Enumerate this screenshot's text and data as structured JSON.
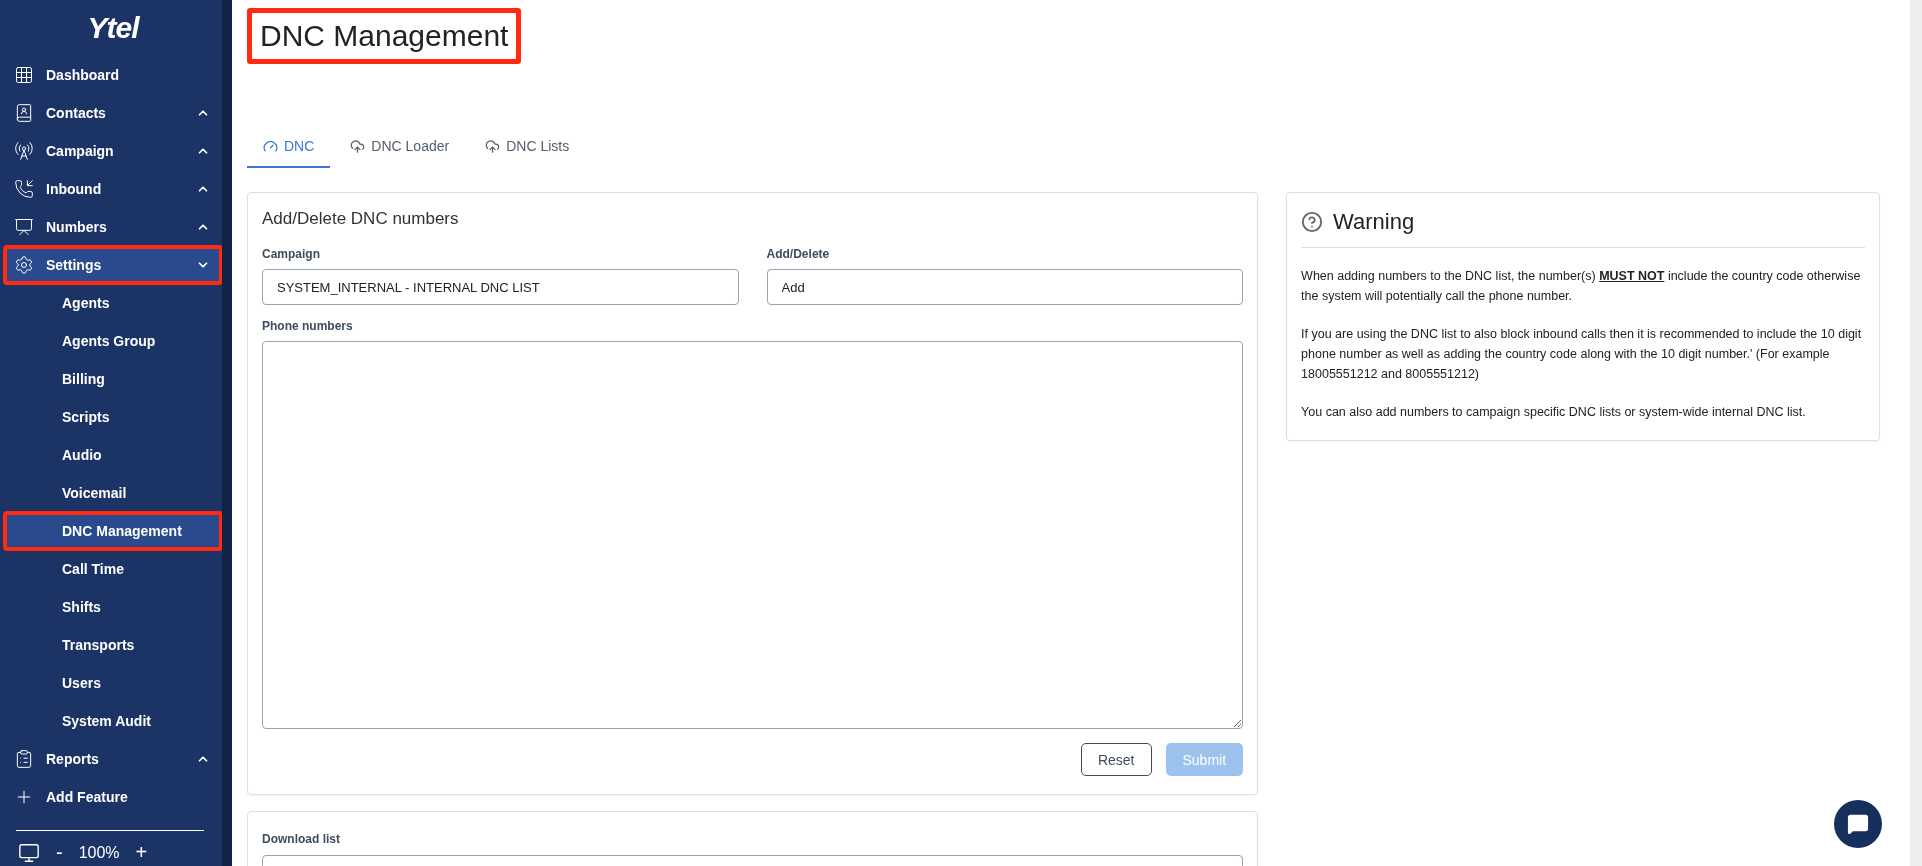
{
  "sidebar": {
    "logo": "Ytel",
    "items": [
      {
        "label": "Dashboard",
        "selected": false,
        "highlighted": false
      },
      {
        "label": "Contacts",
        "selected": false,
        "highlighted": false,
        "expanded": false
      },
      {
        "label": "Campaign",
        "selected": false,
        "highlighted": false,
        "expanded": false
      },
      {
        "label": "Inbound",
        "selected": false,
        "highlighted": false,
        "expanded": false
      },
      {
        "label": "Numbers",
        "selected": false,
        "highlighted": false,
        "expanded": false
      },
      {
        "label": "Settings",
        "selected": true,
        "highlighted": true,
        "expanded": true,
        "children": [
          {
            "label": "Agents",
            "selected": false,
            "highlighted": false
          },
          {
            "label": "Agents Group",
            "selected": false,
            "highlighted": false
          },
          {
            "label": "Billing",
            "selected": false,
            "highlighted": false
          },
          {
            "label": "Scripts",
            "selected": false,
            "highlighted": false
          },
          {
            "label": "Audio",
            "selected": false,
            "highlighted": false
          },
          {
            "label": "Voicemail",
            "selected": false,
            "highlighted": false
          },
          {
            "label": "DNC Management",
            "selected": true,
            "highlighted": true
          },
          {
            "label": "Call Time",
            "selected": false,
            "highlighted": false
          },
          {
            "label": "Shifts",
            "selected": false,
            "highlighted": false
          },
          {
            "label": "Transports",
            "selected": false,
            "highlighted": false
          },
          {
            "label": "Users",
            "selected": false,
            "highlighted": false
          },
          {
            "label": "System Audit",
            "selected": false,
            "highlighted": false
          }
        ]
      },
      {
        "label": "Reports",
        "selected": false,
        "highlighted": false,
        "expanded": false
      },
      {
        "label": "Add Feature",
        "selected": false,
        "highlighted": false
      }
    ],
    "zoom": {
      "minus": "-",
      "value": "100%",
      "plus": "+"
    }
  },
  "page_title": {
    "text": "DNC Management",
    "highlighted": true
  },
  "tabs": [
    {
      "label": "DNC",
      "selected": true
    },
    {
      "label": "DNC Loader",
      "selected": false
    },
    {
      "label": "DNC Lists",
      "selected": false
    }
  ],
  "form": {
    "title": "Add/Delete DNC numbers",
    "campaign": {
      "label": "Campaign",
      "value": "SYSTEM_INTERNAL - INTERNAL DNC LIST"
    },
    "action": {
      "label": "Add/Delete",
      "value": "Add"
    },
    "phone_numbers": {
      "label": "Phone numbers"
    },
    "buttons": [
      {
        "label": "Reset",
        "kind": "outline",
        "disabled": false
      },
      {
        "label": "Submit",
        "kind": "primary",
        "disabled": true
      }
    ]
  },
  "download": {
    "label": "Download list"
  },
  "warning": {
    "title": "Warning",
    "paragraphs": [
      "When adding numbers to the DNC list, the number(s)  **MUST NOT** include the country code otherwise the system will potentially call the phone number.",
      "If you are using the DNC list to also block inbound calls then it is recommended to include the 10 digit phone number as well as adding the country code along with the 10 digit number.' (For example 18005551212 and 8005551212)",
      "You can also add numbers to campaign specific DNC lists or system-wide internal DNC list."
    ]
  }
}
